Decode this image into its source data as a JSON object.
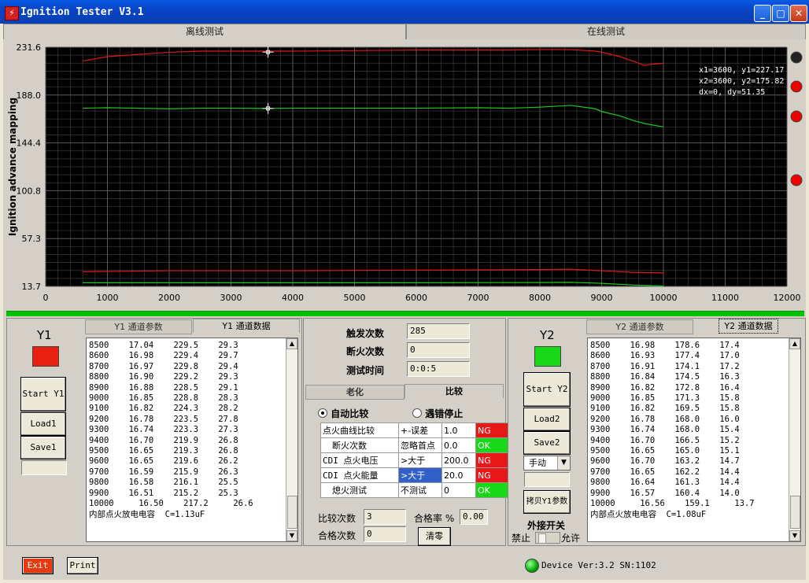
{
  "window": {
    "title": "Ignition Tester V3.1"
  },
  "top_tabs": [
    "离线测试",
    "在线测试"
  ],
  "chart_data": {
    "type": "line",
    "ylabel": "Ignition advance mapping",
    "xlabel": "",
    "xlim": [
      0,
      12000
    ],
    "ylim": [
      13.7,
      231.6
    ],
    "xticks": [
      "0",
      "1000",
      "2000",
      "3000",
      "4000",
      "5000",
      "6000",
      "7000",
      "8000",
      "9000",
      "10000",
      "11000",
      "12000"
    ],
    "yticks": [
      "231.6",
      "188.0",
      "144.4",
      "100.8",
      "57.3",
      "13.7"
    ],
    "grid": true,
    "colors": {
      "background": "#000000",
      "grid": "#5a5a5a",
      "y1": "#e01818",
      "y2": "#1ec81e"
    },
    "series": [
      {
        "x": [
          600,
          1000,
          1500,
          2000,
          2500,
          3000,
          3600,
          4000,
          5000,
          6000,
          7000,
          7500,
          8000,
          8500,
          8900,
          9000,
          9300,
          9500,
          9700,
          9800,
          10000
        ],
        "values": [
          219,
          223,
          225,
          227,
          228,
          228,
          228,
          228,
          228.5,
          229,
          229,
          229,
          229.5,
          229.4,
          228,
          227,
          223,
          219,
          215,
          216,
          217
        ]
      },
      {
        "x": [
          600,
          1000,
          1500,
          2000,
          2500,
          3000,
          3600,
          4000,
          5000,
          6000,
          7000,
          7500,
          8000,
          8500,
          8900,
          9000,
          9300,
          9500,
          9700,
          9800,
          10000
        ],
        "values": [
          176,
          176.5,
          176,
          175.5,
          176,
          176,
          175.8,
          176,
          176,
          176,
          176.5,
          176,
          177,
          178.6,
          175.5,
          173,
          169,
          165,
          162,
          161,
          159
        ]
      },
      {
        "x": [
          600,
          2000,
          4000,
          6000,
          8000,
          8500,
          9000,
          9500,
          10000
        ],
        "values": [
          27,
          28,
          28,
          28.5,
          29,
          29.3,
          28,
          26.5,
          26
        ]
      },
      {
        "x": [
          600,
          2000,
          4000,
          6000,
          8000,
          8500,
          9000,
          9500,
          10000
        ],
        "values": [
          17,
          17,
          17,
          17,
          17.2,
          17.4,
          16.5,
          15,
          14
        ]
      }
    ],
    "cursor_readout": [
      "x1=3600, y1=227.17",
      "x2=3600, y2=175.82",
      "dx=0, dy=51.35"
    ],
    "cursor1": {
      "x": 3600,
      "y": 227.17
    },
    "cursor2": {
      "x": 3600,
      "y": 175.82
    }
  },
  "y1": {
    "label": "Y1",
    "tabs": [
      "Y1 通道参数",
      "Y1 通道数据"
    ],
    "buttons": {
      "start": "Start Y1",
      "load": "Load1",
      "save": "Save1"
    },
    "rows": [
      "8500    17.04    229.5    29.3",
      "8600    16.98    229.4    29.7",
      "8700    16.97    229.8    29.4",
      "8800    16.90    229.2    29.3",
      "8900    16.88    228.5    29.1",
      "9000    16.85    228.8    28.3",
      "9100    16.82    224.3    28.2",
      "9200    16.78    223.5    27.8",
      "9300    16.74    223.3    27.3",
      "9400    16.70    219.9    26.8",
      "9500    16.65    219.3    26.8",
      "9600    16.65    219.6    26.2",
      "9700    16.59    215.9    26.3",
      "9800    16.58    216.1    25.5",
      "9900    16.51    215.2    25.3",
      "10000     16.50    217.2     26.6",
      "内部点火放电电容  C=1.13uF"
    ]
  },
  "center": {
    "trigger_label": "触发次数",
    "trigger_value": "285",
    "misfire_label": "断火次数",
    "misfire_value": "0",
    "time_label": "测试时间",
    "time_value": "0:0:5",
    "tabs": [
      "老化",
      "比较"
    ],
    "radio_auto": "自动比较",
    "radio_stop": "遇错停止",
    "compare_rows": [
      {
        "name": "点火曲线比较",
        "cond": "+-误差",
        "value": "1.0",
        "result": "NG"
      },
      {
        "name": "断火次数",
        "cond": "忽略首点",
        "value": "0.0",
        "result": "OK"
      },
      {
        "name": "CDI 点火电压",
        "cond": ">大于",
        "value": "200.0",
        "result": "NG"
      },
      {
        "name": "CDI 点火能量",
        "cond": ">大于",
        "value": "20.0",
        "result": "NG"
      },
      {
        "name": "熄火测试",
        "cond": "不测试",
        "value": "0",
        "result": "OK"
      }
    ],
    "compare_count_label": "比较次数",
    "compare_count": "3",
    "pass_count_label": "合格次数",
    "pass_count": "0",
    "pass_rate_label": "合格率 %",
    "pass_rate": "0.00",
    "clear_button": "清零"
  },
  "y2": {
    "label": "Y2",
    "tabs": [
      "Y2 通道参数",
      "Y2 通道数据"
    ],
    "buttons": {
      "start": "Start Y2",
      "load": "Load2",
      "save": "Save2",
      "copy": "拷贝Y1参数"
    },
    "mode": "手动",
    "switch_title": "外接开关",
    "switch_off": "禁止",
    "switch_on": "允许",
    "rows": [
      "8500    16.98    178.6    17.4",
      "8600    16.93    177.4    17.0",
      "8700    16.91    174.1    17.2",
      "8800    16.84    174.5    16.3",
      "8900    16.82    172.8    16.4",
      "9000    16.85    171.3    15.8",
      "9100    16.82    169.5    15.8",
      "9200    16.78    168.0    16.0",
      "9300    16.74    168.0    15.4",
      "9400    16.70    166.5    15.2",
      "9500    16.65    165.0    15.1",
      "9600    16.70    163.2    14.7",
      "9700    16.65    162.2    14.4",
      "9800    16.64    161.3    14.4",
      "9900    16.57    160.4    14.0",
      "10000     16.56    159.1     13.7",
      "内部点火放电电容  C=1.08uF"
    ]
  },
  "status": {
    "exit": "Exit",
    "print": "Print",
    "device": "Device Ver:3.2  SN:1102"
  }
}
